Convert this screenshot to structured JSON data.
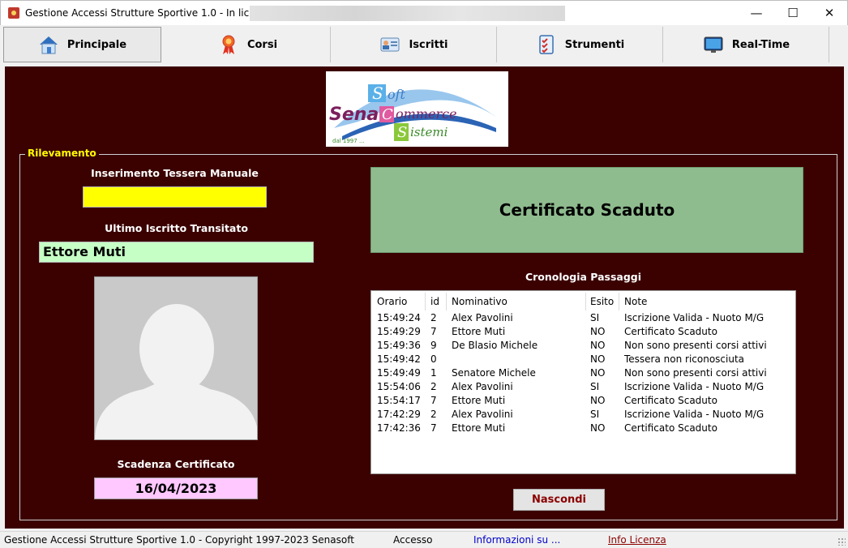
{
  "window": {
    "title": "Gestione Accessi Strutture Sportive 1.0 - In licenza a:",
    "minimize_glyph": "—",
    "maximize_glyph": "☐",
    "close_glyph": "✕"
  },
  "tabs": [
    {
      "label": "Principale",
      "icon": "house-icon",
      "active": true
    },
    {
      "label": "Corsi",
      "icon": "award-ribbon-icon"
    },
    {
      "label": "Iscritti",
      "icon": "id-card-icon"
    },
    {
      "label": "Strumenti",
      "icon": "checklist-icon"
    },
    {
      "label": "Real-Time",
      "icon": "monitor-icon"
    }
  ],
  "logo": {
    "text": "Soft Sena Commerce Sistemi",
    "since": "dal 1997 ..."
  },
  "rilevamento": {
    "group_title": "Rilevamento",
    "manual_label": "Inserimento Tessera Manuale",
    "manual_value": "",
    "last_label": "Ultimo Iscritto Transitato",
    "last_value": "Ettore Muti",
    "cert_label": "Scadenza Certificato",
    "cert_value": "16/04/2023",
    "status_text": "Certificato Scaduto",
    "history_label": "Cronologia Passaggi",
    "hide_button": "Nascondi"
  },
  "history": {
    "columns": [
      "Orario",
      "id",
      "Nominativo",
      "Esito",
      "Note"
    ],
    "rows": [
      [
        "15:49:24",
        "2",
        "Alex Pavolini",
        "SI",
        "Iscrizione Valida - Nuoto M/G"
      ],
      [
        "15:49:29",
        "7",
        "Ettore Muti",
        "NO",
        "Certificato Scaduto"
      ],
      [
        "15:49:36",
        "9",
        "De Blasio Michele",
        "NO",
        "Non sono presenti corsi attivi"
      ],
      [
        "15:49:42",
        "0",
        "",
        "NO",
        "Tessera non riconosciuta"
      ],
      [
        "15:49:49",
        "1",
        "Senatore Michele",
        "NO",
        "Non sono presenti corsi attivi"
      ],
      [
        "15:54:06",
        "2",
        "Alex Pavolini",
        "SI",
        "Iscrizione Valida - Nuoto M/G"
      ],
      [
        "15:54:17",
        "7",
        "Ettore Muti",
        "NO",
        "Certificato Scaduto"
      ],
      [
        "17:42:29",
        "2",
        "Alex Pavolini",
        "SI",
        "Iscrizione Valida - Nuoto M/G"
      ],
      [
        "17:42:36",
        "7",
        "Ettore Muti",
        "NO",
        "Certificato Scaduto"
      ]
    ]
  },
  "statusbar": {
    "copyright": "Gestione Accessi Strutture Sportive 1.0 - Copyright 1997-2023 Senasoft",
    "mode": "Accesso",
    "info_link": "Informazioni su ...",
    "license_link": "Info Licenza"
  },
  "colors": {
    "panel_bg": "#3b0000",
    "status_box": "#8fbc8f",
    "manual_field": "#ffff00",
    "last_field": "#c6ffc6",
    "cert_field": "#ffc8ff",
    "group_title": "#ffff00"
  }
}
